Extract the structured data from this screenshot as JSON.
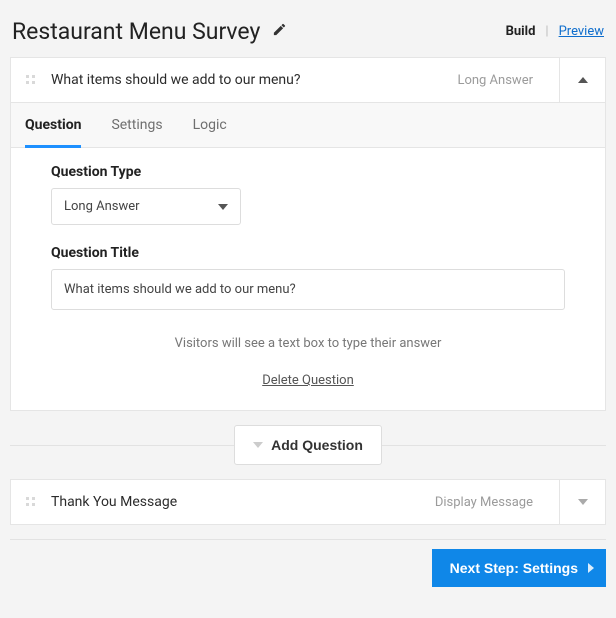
{
  "header": {
    "title": "Restaurant Menu Survey",
    "build_label": "Build",
    "preview_label": "Preview"
  },
  "question_panel": {
    "title": "What items should we add to our menu?",
    "type_label": "Long Answer"
  },
  "tabs": {
    "question": "Question",
    "settings": "Settings",
    "logic": "Logic"
  },
  "form": {
    "type_label": "Question Type",
    "type_value": "Long Answer",
    "title_label": "Question Title",
    "title_value": "What items should we add to our menu?",
    "hint": "Visitors will see a text box to type their answer",
    "delete_label": "Delete Question"
  },
  "add_button": "Add Question",
  "thankyou_panel": {
    "title": "Thank You Message",
    "type_label": "Display Message"
  },
  "next_button": "Next Step: Settings"
}
